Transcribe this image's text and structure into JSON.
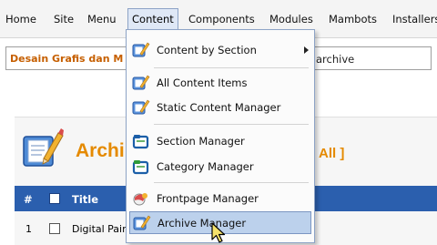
{
  "menubar": {
    "items": [
      "Home",
      "Site",
      "Menu",
      "Content",
      "Components",
      "Modules",
      "Mambots",
      "Installers"
    ],
    "active_index": 3
  },
  "pathway": {
    "site_name": "Desain Grafis dan M",
    "current": "archive"
  },
  "page": {
    "heading": "Archi",
    "heading_suffix": "All ]"
  },
  "table": {
    "header": {
      "number": "#",
      "title": "Title"
    },
    "rows": [
      {
        "number": "1",
        "title": "Digital Pain"
      }
    ]
  },
  "content_menu": {
    "items": [
      {
        "label": "Content by Section",
        "icon": "pencil-icon",
        "submenu": true
      },
      {
        "label": "All Content Items",
        "icon": "pencil-icon"
      },
      {
        "label": "Static Content Manager",
        "icon": "pencil-icon"
      },
      {
        "label": "Section Manager",
        "icon": "folder-icon"
      },
      {
        "label": "Category Manager",
        "icon": "folder-icon"
      },
      {
        "label": "Frontpage Manager",
        "icon": "frontpage-icon"
      },
      {
        "label": "Archive Manager",
        "icon": "pencil-icon",
        "highlighted": true
      }
    ]
  },
  "colors": {
    "accent_orange": "#e58a00",
    "header_blue": "#2b5fae",
    "menu_highlight": "#bcd1ec",
    "site_name": "#c65f00"
  }
}
